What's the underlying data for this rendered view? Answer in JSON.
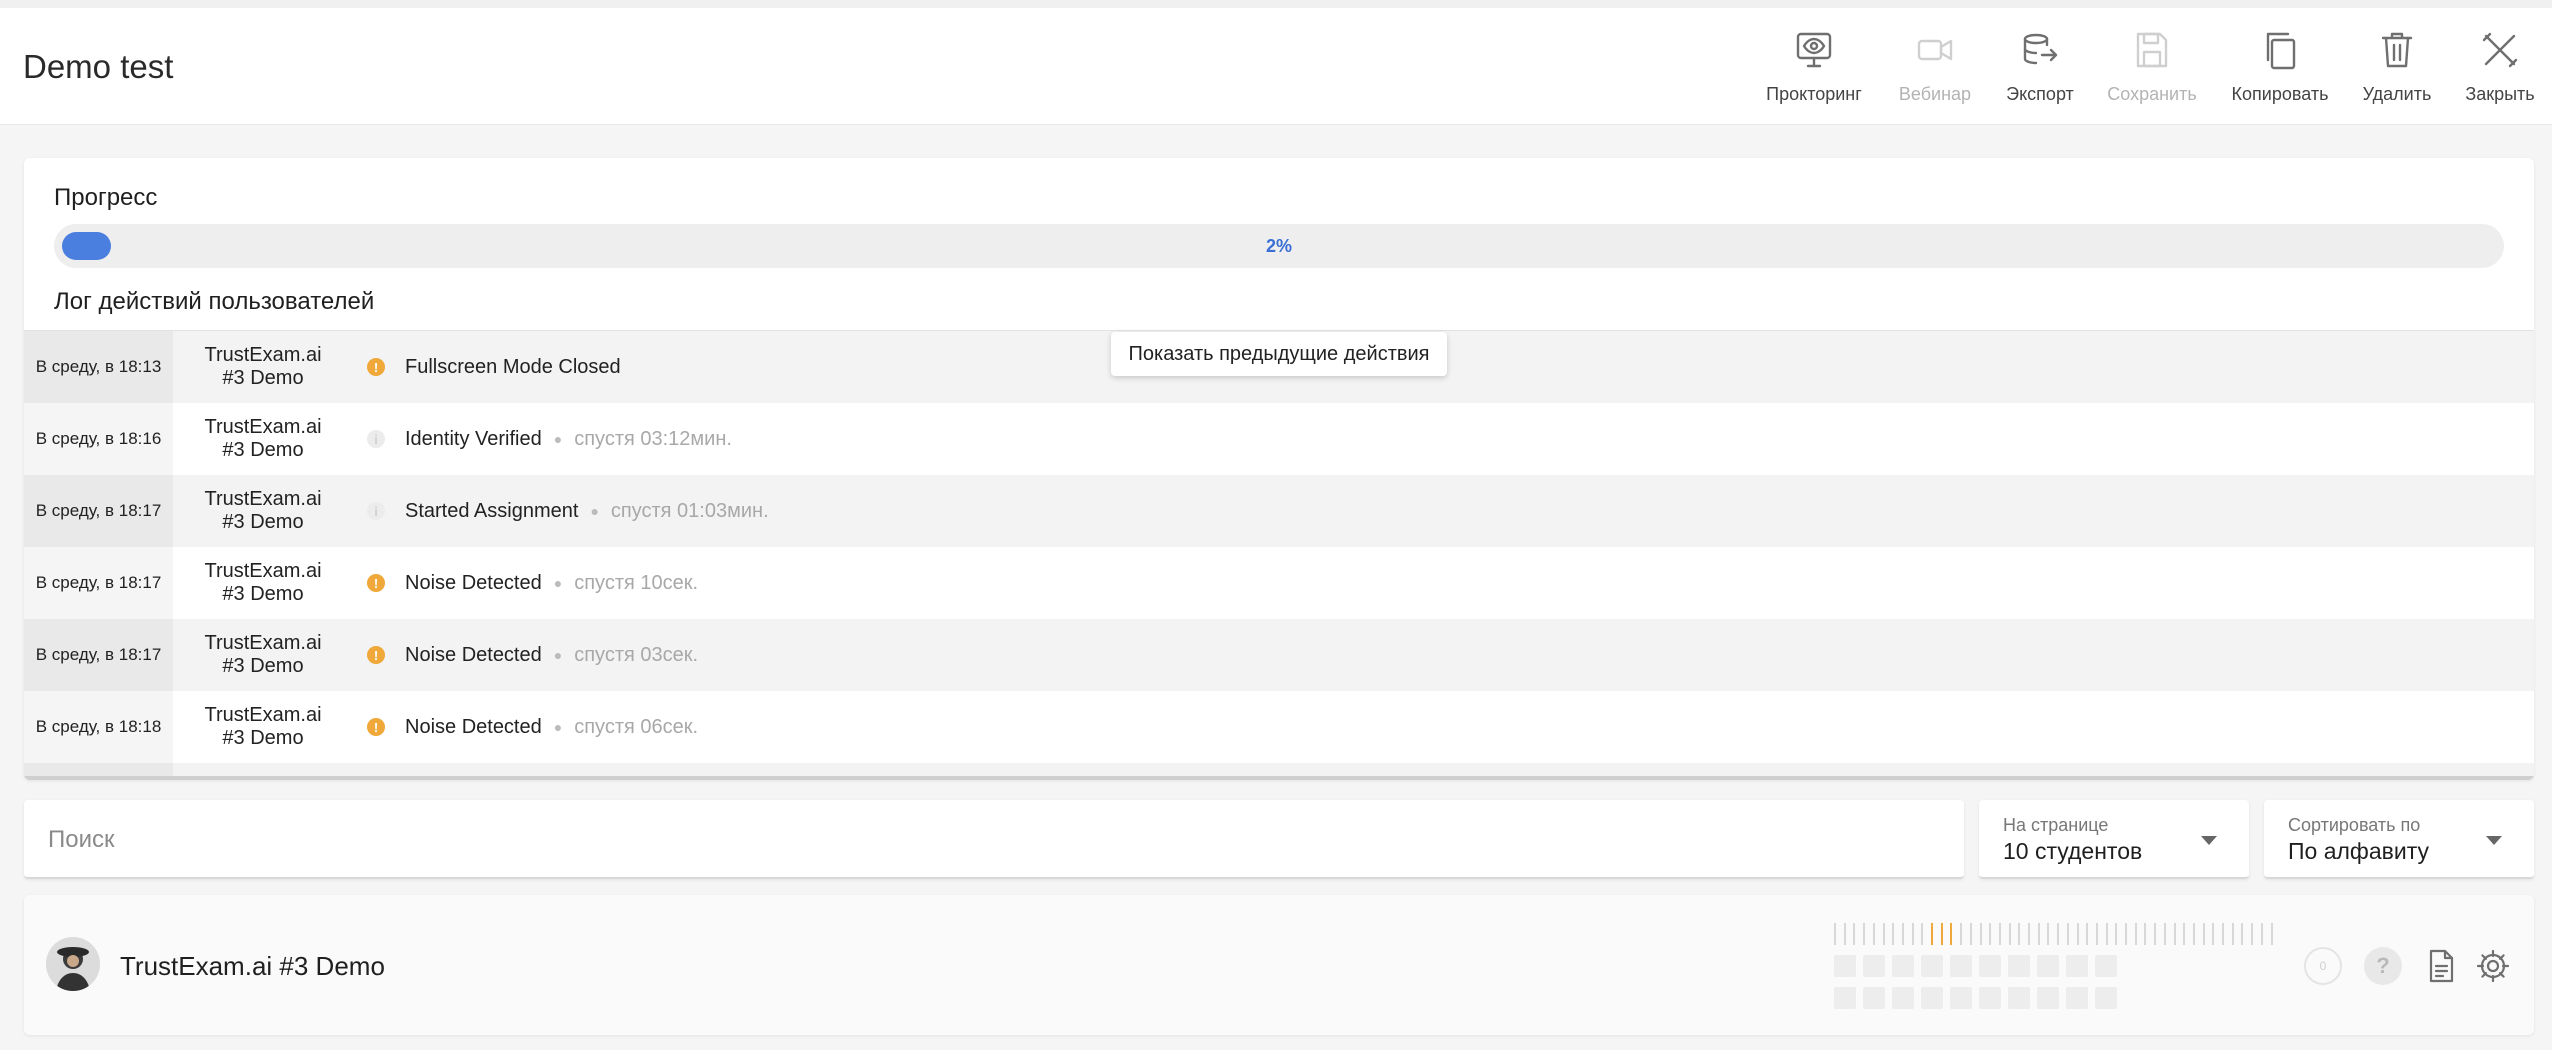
{
  "header": {
    "title": "Demo test",
    "toolbar": [
      {
        "id": "proctoring",
        "label": "Прокторинг",
        "icon": "monitor-eye-icon",
        "disabled": false
      },
      {
        "id": "webinar",
        "label": "Вебинар",
        "icon": "video-camera-icon",
        "disabled": true
      },
      {
        "id": "export",
        "label": "Экспорт",
        "icon": "database-export-icon",
        "disabled": false
      },
      {
        "id": "save",
        "label": "Сохранить",
        "icon": "floppy-disk-icon",
        "disabled": true
      },
      {
        "id": "copy",
        "label": "Копировать",
        "icon": "copy-icon",
        "disabled": false
      },
      {
        "id": "delete",
        "label": "Удалить",
        "icon": "trash-icon",
        "disabled": false
      },
      {
        "id": "close",
        "label": "Закрыть",
        "icon": "close-tools-icon",
        "disabled": false
      }
    ]
  },
  "progress": {
    "title": "Прогресс",
    "percent_label": "2%",
    "percent": 2
  },
  "log": {
    "title": "Лог действий пользователей",
    "show_previous_label": "Показать предыдущие действия",
    "rows": [
      {
        "time": "В среду, в 18:13",
        "user_line1": "TrustExam.ai",
        "user_line2": "#3 Demo",
        "status": "warn",
        "action": "Fullscreen Mode Closed",
        "ago": ""
      },
      {
        "time": "В среду, в 18:16",
        "user_line1": "TrustExam.ai",
        "user_line2": "#3 Demo",
        "status": "info",
        "action": "Identity Verified",
        "ago": "спустя 03:12мин."
      },
      {
        "time": "В среду, в 18:17",
        "user_line1": "TrustExam.ai",
        "user_line2": "#3 Demo",
        "status": "info",
        "action": "Started Assignment",
        "ago": "спустя 01:03мин."
      },
      {
        "time": "В среду, в 18:17",
        "user_line1": "TrustExam.ai",
        "user_line2": "#3 Demo",
        "status": "warn",
        "action": "Noise Detected",
        "ago": "спустя 10сек."
      },
      {
        "time": "В среду, в 18:17",
        "user_line1": "TrustExam.ai",
        "user_line2": "#3 Demo",
        "status": "warn",
        "action": "Noise Detected",
        "ago": "спустя 03сек."
      },
      {
        "time": "В среду, в 18:18",
        "user_line1": "TrustExam.ai",
        "user_line2": "#3 Demo",
        "status": "warn",
        "action": "Noise Detected",
        "ago": "спустя 06сек."
      }
    ]
  },
  "filters": {
    "search_placeholder": "Поиск",
    "per_page": {
      "caption": "На странице",
      "value": "10 студентов"
    },
    "sort": {
      "caption": "Сортировать по",
      "value": "По алфавиту"
    }
  },
  "student": {
    "name": "TrustExam.ai #3 Demo",
    "counter": "0",
    "help_glyph": "?"
  },
  "colors": {
    "accent": "#4a7fe0",
    "warning": "#f0a83a"
  }
}
